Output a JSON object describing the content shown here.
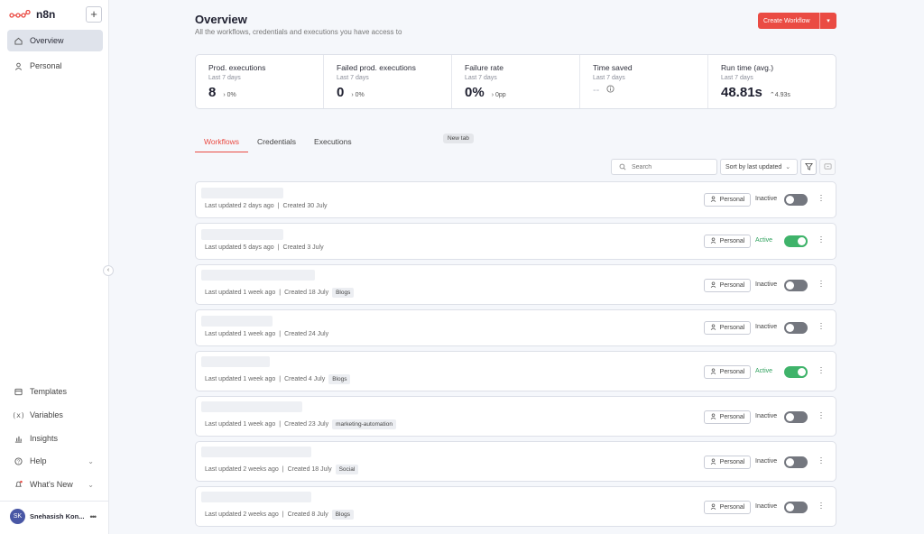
{
  "app": {
    "name": "n8n",
    "brand_color": "#ea4b43"
  },
  "sidebar": {
    "add_label": "+",
    "items": [
      {
        "label": "Overview",
        "icon": "home-icon",
        "active": true
      },
      {
        "label": "Personal",
        "icon": "user-icon",
        "active": false
      }
    ],
    "bottom_items": [
      {
        "label": "Templates",
        "icon": "templates-icon"
      },
      {
        "label": "Variables",
        "icon": "variables-icon"
      },
      {
        "label": "Insights",
        "icon": "insights-icon"
      },
      {
        "label": "Help",
        "icon": "help-icon"
      },
      {
        "label": "What's New",
        "icon": "bell-icon"
      }
    ],
    "user": {
      "initials": "SK",
      "name": "Snehasish Kon..."
    }
  },
  "header": {
    "title": "Overview",
    "subtitle": "All the workflows, credentials and executions you have access to",
    "create_label": "Create Workflow"
  },
  "stats": [
    {
      "label": "Prod. executions",
      "period": "Last 7 days",
      "value": "8",
      "delta": "0%"
    },
    {
      "label": "Failed prod. executions",
      "period": "Last 7 days",
      "value": "0",
      "delta": "0%"
    },
    {
      "label": "Failure rate",
      "period": "Last 7 days",
      "value": "0%",
      "delta": "0pp"
    },
    {
      "label": "Time saved",
      "period": "Last 7 days",
      "value": "--",
      "delta": ""
    },
    {
      "label": "Run time (avg.)",
      "period": "Last 7 days",
      "value": "48.81s",
      "delta": "4.93s"
    }
  ],
  "tabs": [
    "Workflows",
    "Credentials",
    "Executions"
  ],
  "tooltip": "New tab",
  "toolbar": {
    "search_placeholder": "Search",
    "sort_label": "Sort by last updated"
  },
  "workflows": [
    {
      "updated": "Last updated 2 days ago",
      "created": "Created 30 July",
      "tag": "",
      "owner": "Personal",
      "status": "Inactive",
      "active": false
    },
    {
      "updated": "Last updated 5 days ago",
      "created": "Created 3 July",
      "tag": "",
      "owner": "Personal",
      "status": "Active",
      "active": true
    },
    {
      "updated": "Last updated 1 week ago",
      "created": "Created 18 July",
      "tag": "Blogs",
      "owner": "Personal",
      "status": "Inactive",
      "active": false
    },
    {
      "updated": "Last updated 1 week ago",
      "created": "Created 24 July",
      "tag": "",
      "owner": "Personal",
      "status": "Inactive",
      "active": false
    },
    {
      "updated": "Last updated 1 week ago",
      "created": "Created 4 July",
      "tag": "Blogs",
      "owner": "Personal",
      "status": "Active",
      "active": true
    },
    {
      "updated": "Last updated 1 week ago",
      "created": "Created 23 July",
      "tag": "marketing-automation",
      "owner": "Personal",
      "status": "Inactive",
      "active": false
    },
    {
      "updated": "Last updated 2 weeks ago",
      "created": "Created 18 July",
      "tag": "Social",
      "owner": "Personal",
      "status": "Inactive",
      "active": false
    },
    {
      "updated": "Last updated 2 weeks ago",
      "created": "Created 8 July",
      "tag": "Blogs",
      "owner": "Personal",
      "status": "Inactive",
      "active": false
    }
  ]
}
